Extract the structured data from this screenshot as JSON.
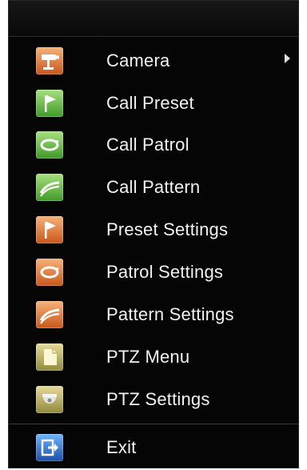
{
  "menu": {
    "items": [
      {
        "label": "Camera",
        "icon": "camera-icon",
        "color": "#d86a2a",
        "has_submenu": true
      },
      {
        "label": "Call Preset",
        "icon": "preset-flag-icon",
        "color": "#4aa92e",
        "has_submenu": false
      },
      {
        "label": "Call Patrol",
        "icon": "patrol-loop-icon",
        "color": "#4aa92e",
        "has_submenu": false
      },
      {
        "label": "Call Pattern",
        "icon": "pattern-curve-icon",
        "color": "#4aa92e",
        "has_submenu": false
      },
      {
        "label": "Preset Settings",
        "icon": "preset-flag-icon",
        "color": "#d86a2a",
        "has_submenu": false
      },
      {
        "label": "Patrol Settings",
        "icon": "patrol-loop-icon",
        "color": "#d86a2a",
        "has_submenu": false
      },
      {
        "label": "Pattern Settings",
        "icon": "pattern-curve-icon",
        "color": "#d86a2a",
        "has_submenu": false
      },
      {
        "label": "PTZ Menu",
        "icon": "document-icon",
        "color": "#a7a04a",
        "has_submenu": false
      },
      {
        "label": "PTZ Settings",
        "icon": "dome-camera-icon",
        "color": "#a7a04a",
        "has_submenu": false
      },
      {
        "label": "Exit",
        "icon": "exit-icon",
        "color": "#2d6fd6",
        "has_submenu": false
      }
    ]
  },
  "colors": {
    "menu_background": "#050505",
    "text": "#f2f2f2"
  }
}
